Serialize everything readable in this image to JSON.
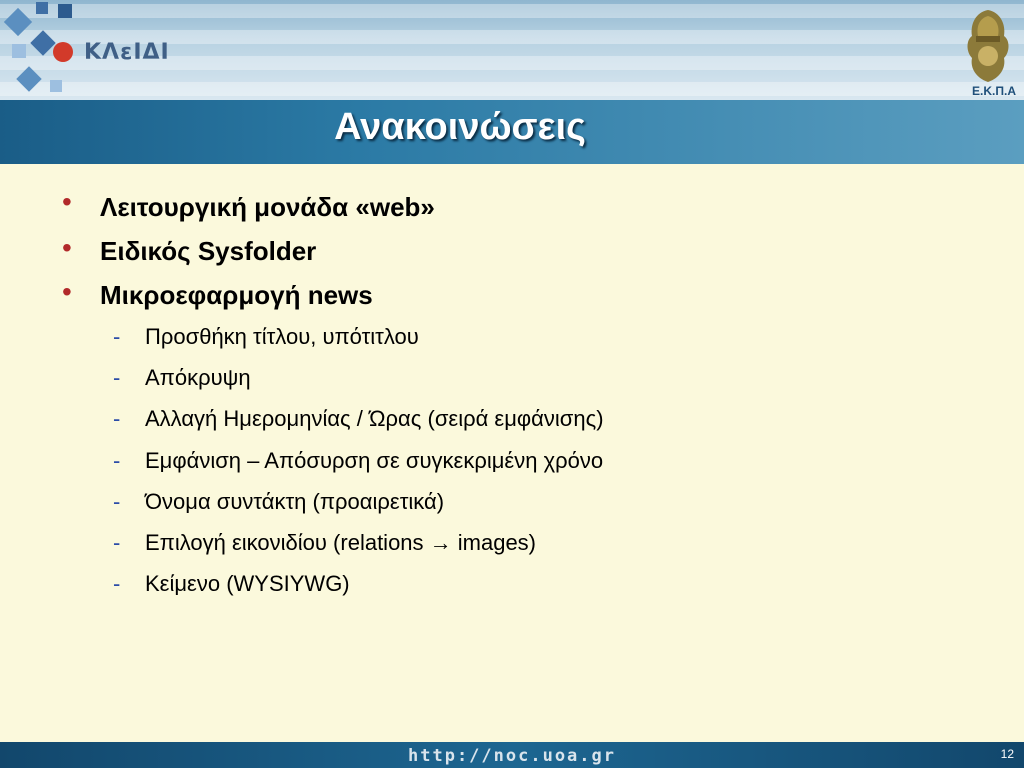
{
  "header": {
    "logo_text": "ΚΛεΙΔΙ",
    "crest_label": "Ε.Κ.Π.Α"
  },
  "slide": {
    "title": "Ανακοινώσεις",
    "bullets": [
      {
        "text": "Λειτουργική μονάδα «web»"
      },
      {
        "text": "Ειδικός Sysfolder"
      },
      {
        "text": "Μικροεφαρμογή news"
      }
    ],
    "sub_bullets": [
      "Προσθήκη τίτλου, υπότιτλου",
      "Απόκρυψη",
      "Αλλαγή Ημερομηνίας / Ώρας (σειρά εμφάνισης)",
      "Εμφάνιση – Απόσυρση σε συγκεκριμένη χρόνο",
      "Όνομα συντάκτη (προαιρετικά)",
      "Επιλογή εικονιδίου (relations → images)",
      "Κείμενο (WYSIYWG)"
    ],
    "dash": "-"
  },
  "footer": {
    "url": "http://noc.uoa.gr",
    "page_number": "12"
  },
  "colors": {
    "background": "#fbf9dc",
    "title_bar": "#2b7aa5",
    "bullet": "#b22a2a",
    "dash": "#2b4ca8"
  }
}
